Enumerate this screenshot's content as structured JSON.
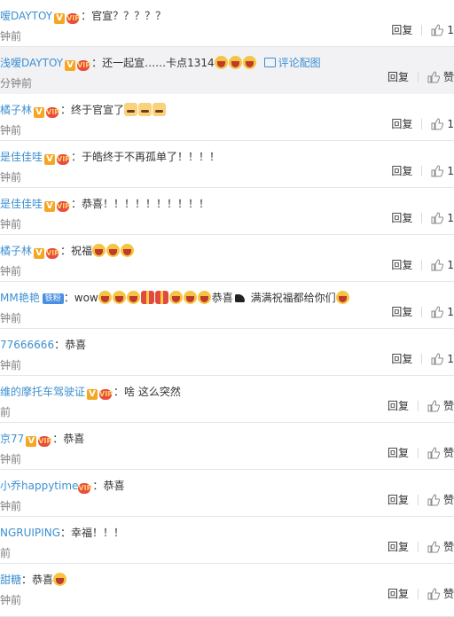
{
  "reply_label": "回复",
  "like_label": "赞",
  "comments": [
    {
      "user": "嗳DAYTOY",
      "v": true,
      "vip": true,
      "colon": "：",
      "text": "官宣？？？？？",
      "emojis": [],
      "time": "钟前",
      "likes": "1"
    },
    {
      "user": "浅嗳DAYTOY",
      "v": true,
      "vip": true,
      "colon": "：",
      "text": "还一起宣……卡点1314",
      "emojis": [
        "lol",
        "lol",
        "lol"
      ],
      "pic": "评论配图",
      "time": "分钟前",
      "likes": ""
    },
    {
      "user": "橘子林",
      "v": true,
      "vip": true,
      "colon": "：",
      "text": "终于官宣了",
      "emojis": [
        "cat",
        "cat",
        "cat"
      ],
      "time": "钟前",
      "likes": "1"
    },
    {
      "user": "是佳佳哇",
      "v": true,
      "vip": true,
      "colon": "：",
      "text": "于皓终于不再孤单了！！！！",
      "emojis": [],
      "time": "钟前",
      "likes": "1"
    },
    {
      "user": "是佳佳哇",
      "v": true,
      "vip": true,
      "colon": "：",
      "text": "恭喜！！！！！！！！！！",
      "emojis": [],
      "time": "钟前",
      "likes": "1"
    },
    {
      "user": "橘子林",
      "v": true,
      "vip": true,
      "colon": "：",
      "text": "祝福",
      "emojis": [
        "lol",
        "lol",
        "lol"
      ],
      "time": "钟前",
      "likes": "1"
    },
    {
      "user": "MM艳艳",
      "v": false,
      "vip": false,
      "fan": "铁粉",
      "colon": "：",
      "text": "wow",
      "emojis": [
        "lol",
        "lol",
        "lol",
        "gift",
        "gift",
        "lol",
        "lol",
        "lol"
      ],
      "text2": "恭喜",
      "emojis2": [
        "hat"
      ],
      "text3": " 满满祝福都给你们",
      "emojis3": [
        "lol"
      ],
      "time": "钟前",
      "likes": "1"
    },
    {
      "user": "77666666",
      "v": false,
      "vip": false,
      "colon": "：",
      "text": "恭喜",
      "emojis": [],
      "time": "钟前",
      "likes": "1"
    },
    {
      "user": "维的摩托车驾驶证",
      "v": true,
      "vip": true,
      "colon": "：",
      "text": "啥 这么突然",
      "emojis": [],
      "time": "前",
      "likes": ""
    },
    {
      "user": "京77",
      "v": true,
      "vip": true,
      "colon": "：",
      "text": "恭喜",
      "emojis": [],
      "time": "钟前",
      "likes": ""
    },
    {
      "user": "小乔happytime",
      "v": false,
      "vip": true,
      "colon": "：",
      "text": "恭喜",
      "emojis": [],
      "time": "钟前",
      "likes": ""
    },
    {
      "user": "NGRUIPING",
      "v": false,
      "vip": false,
      "colon": "：",
      "text": "幸福！！！",
      "emojis": [],
      "time": "前",
      "likes": ""
    },
    {
      "user": "甜糖",
      "v": false,
      "vip": false,
      "colon": "：",
      "text": "恭喜",
      "emojis": [
        "lol"
      ],
      "time": "钟前",
      "likes": ""
    }
  ]
}
